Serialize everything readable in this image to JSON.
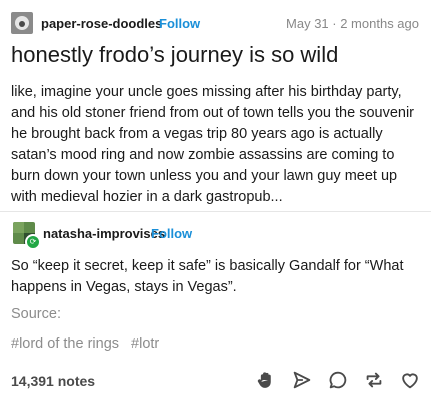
{
  "op": {
    "username": "paper-rose-doodles",
    "follow_label": "Follow",
    "date": "May 31 · 2 months ago"
  },
  "post": {
    "title": "honestly frodo’s journey is so wild",
    "body": "like, imagine your uncle goes missing after his birthday party, and his old stoner friend from out of town tells you the souvenir he brought back from a vegas trip 80 years ago is actually satan’s mood ring and now zombie assassins are coming to burn down your town unless you and your lawn guy meet up with medieval hozier in a dark gastropub..."
  },
  "reblog": {
    "username": "natasha-improvises",
    "follow_label": "Follow",
    "body": "So “keep it secret, keep it safe” is basically Gandalf for “What happens in Vegas, stays in Vegas”."
  },
  "source_label": "Source:",
  "tags": [
    "#lord of the rings",
    "#lotr"
  ],
  "notes": "14,391 notes",
  "actions": [
    "hand-icon",
    "share-icon",
    "reply-icon",
    "reblog-icon",
    "like-icon"
  ],
  "colors": {
    "accent": "#1a8fd8",
    "muted": "#8c8c8c",
    "reblog_badge": "#22a745"
  }
}
